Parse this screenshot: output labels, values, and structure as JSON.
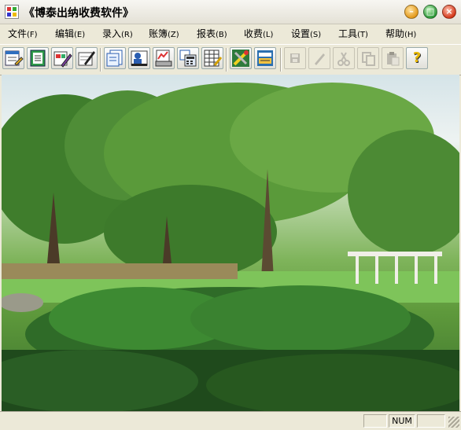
{
  "window": {
    "title": "《博泰出纳收费软件》"
  },
  "menu": [
    {
      "label": "文件",
      "key": "(F)"
    },
    {
      "label": "编辑",
      "key": "(E)"
    },
    {
      "label": "录入",
      "key": "(R)"
    },
    {
      "label": "账簿",
      "key": "(Z)"
    },
    {
      "label": "报表",
      "key": "(B)"
    },
    {
      "label": "收费",
      "key": "(L)"
    },
    {
      "label": "设置",
      "key": "(S)"
    },
    {
      "label": "工具",
      "key": "(T)"
    },
    {
      "label": "帮助",
      "key": "(H)"
    }
  ],
  "toolbar": {
    "help_glyph": "?",
    "disabled": [
      "save-icon",
      "pencil-icon",
      "cut-icon",
      "copy-icon",
      "paste-icon"
    ]
  },
  "status": {
    "pane1": "",
    "num": "NUM",
    "pane3": ""
  }
}
